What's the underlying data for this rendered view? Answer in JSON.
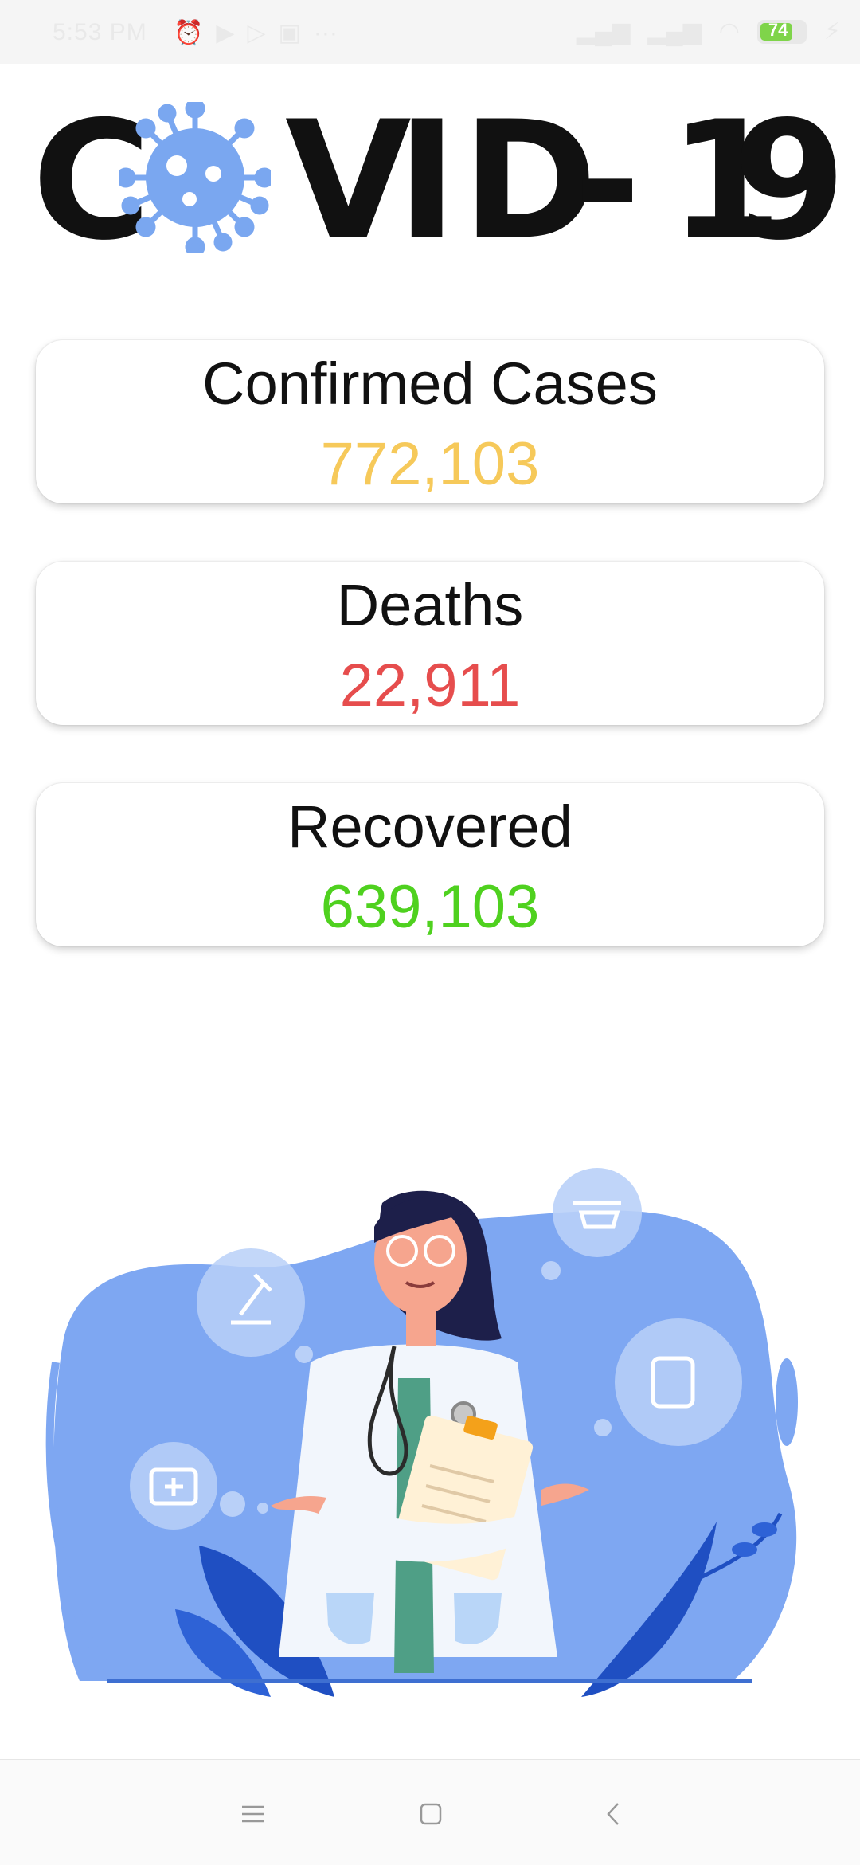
{
  "status_bar": {
    "time": "5:53 PM",
    "battery_level": "74",
    "icons": [
      "alarm-icon",
      "play-icon",
      "play-outline-icon",
      "calendar-icon",
      "more-icon",
      "signal-icon",
      "signal-2-icon",
      "wifi-icon",
      "battery-icon",
      "charging-icon"
    ]
  },
  "header": {
    "logo_letters": [
      "C",
      "O",
      "V",
      "I",
      "D",
      "-",
      "1",
      "9"
    ],
    "virus_color": "#7aa7f0"
  },
  "stats": [
    {
      "label": "Confirmed Cases",
      "value": "772,103",
      "color": "#f6c95a"
    },
    {
      "label": "Deaths",
      "value": "22,911",
      "color": "#e64d4d"
    },
    {
      "label": "Recovered",
      "value": "639,103",
      "color": "#4fd11f"
    }
  ],
  "illustration": {
    "name": "doctor-illustration",
    "blob_color": "#7ea7f2",
    "leaf_color": "#1f4fc2"
  },
  "nav_bar": {
    "icons": [
      "menu-icon",
      "home-icon",
      "back-icon"
    ]
  }
}
